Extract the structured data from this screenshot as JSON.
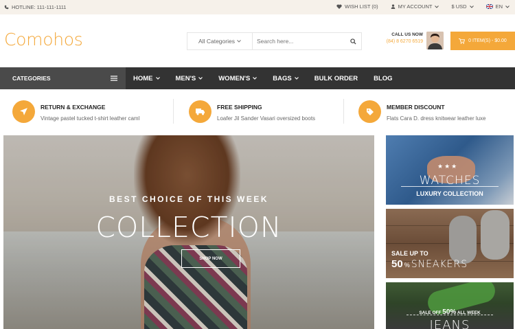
{
  "topbar": {
    "hotline": "HOTLINE: 111-111-1111",
    "wishlist": "WISH LIST (0)",
    "account": "MY ACCOUNT",
    "currency": "$ USD",
    "language": "EN"
  },
  "header": {
    "logo": "Comohos",
    "search_category": "All Categories",
    "search_placeholder": "Search here...",
    "call_us": "CALL US NOW",
    "phone": "(84) 8 6270 6519",
    "cart": "0 ITEM(S) - $0.00"
  },
  "nav": {
    "categories": "CATEGORIES",
    "items": [
      {
        "label": "HOME",
        "dropdown": true
      },
      {
        "label": "MEN'S",
        "dropdown": true
      },
      {
        "label": "WOMEN'S",
        "dropdown": true
      },
      {
        "label": "BAGS",
        "dropdown": true
      },
      {
        "label": "BULK ORDER",
        "dropdown": false
      },
      {
        "label": "BLOG",
        "dropdown": false
      }
    ]
  },
  "features": [
    {
      "title": "RETURN & EXCHANGE",
      "desc": "Vintage pastel tucked t-shirt leather caml"
    },
    {
      "title": "FREE SHIPPING",
      "desc": "Loafer Jil Sander Vasari oversized boots"
    },
    {
      "title": "MEMBER DISCOUNT",
      "desc": "Flats Cara D. dress knitwear leather luxe"
    }
  ],
  "hero": {
    "subtitle": "BEST CHOICE OF THIS WEEK",
    "title": "COLLECTION",
    "button": "SHOP NOW"
  },
  "banners": {
    "watches": {
      "title": "WATCHES",
      "subtitle": "LUXURY COLLECTION"
    },
    "sneakers": {
      "sale": "SALE UP TO",
      "percent": "50",
      "percent_sign": "%",
      "title": "SNEAKERS"
    },
    "jeans": {
      "sale_prefix": "SALE OFF",
      "percent": "50%",
      "sale_suffix": "ALL WEEK",
      "title": "JEANS"
    }
  },
  "colors": {
    "accent": "#f4a83a",
    "nav": "#333333",
    "topbar": "#f6f1ea"
  }
}
